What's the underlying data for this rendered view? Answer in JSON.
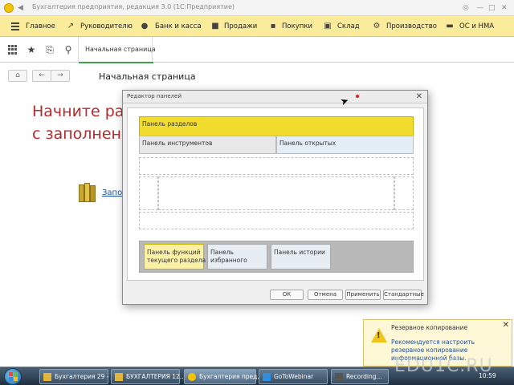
{
  "window": {
    "caption": "Бухгалтерия предприятия, редакция 3.0  (1С:Предприятие)",
    "controls": [
      "⊞",
      "—",
      "□",
      "✕"
    ]
  },
  "sections": {
    "items": [
      {
        "label": "Главное",
        "icon": "menu-icon"
      },
      {
        "label": "Руководителю",
        "icon": "chart-icon"
      },
      {
        "label": "Банк и касса",
        "icon": "bank-icon"
      },
      {
        "label": "Продажи",
        "icon": "bag-icon"
      },
      {
        "label": "Покупки",
        "icon": "cart-icon"
      },
      {
        "label": "Склад",
        "icon": "warehouse-icon"
      },
      {
        "label": "Производство",
        "icon": "factory-icon"
      },
      {
        "label": "ОС и НМА",
        "icon": "truck-icon"
      }
    ]
  },
  "toolbar": {
    "tab_label": "Начальная страница"
  },
  "page": {
    "title": "Начальная страница",
    "headline_line1": "Начните работ",
    "headline_line2": "с заполнения",
    "link_text": "Запо"
  },
  "dialog": {
    "title": "Редактор панелей",
    "panel_sections": "Панель разделов",
    "panel_tools": "Панель инструментов",
    "panel_open": "Панель открытых",
    "panel_functions": "Панель функций\nтекущего раздела",
    "panel_favorites": "Панель\nизбранного",
    "panel_history": "Панель истории",
    "buttons": {
      "ok": "ОК",
      "cancel": "Отмена",
      "apply": "Применить",
      "standard": "Стандартные"
    }
  },
  "notification": {
    "title": "Резервное копирование",
    "body": "Рекомендуется настроить\nрезервное копирование\nинформационной базы."
  },
  "taskbar": {
    "items": [
      {
        "label": "Бухгалтерия 29 - ..."
      },
      {
        "label": "БУХГАЛТЕРИЯ 12..."
      },
      {
        "label": "Бухгалтерия пред..."
      },
      {
        "label": "GoToWebinar"
      },
      {
        "label": "Recording..."
      }
    ],
    "watermark": "EDU1C.RU",
    "clock": "10:59"
  },
  "colors": {
    "sections_bg": "#fbec9b",
    "accent_green": "#3fa34d",
    "headline_red": "#b52a2a",
    "link_blue": "#1a4e9c",
    "panel_yellow": "#f2dc2e"
  }
}
